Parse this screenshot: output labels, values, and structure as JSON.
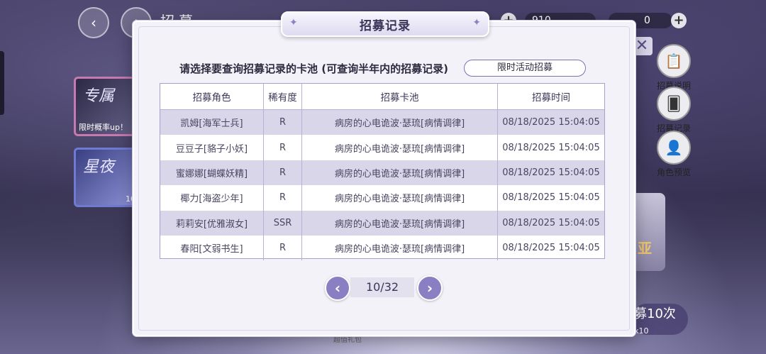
{
  "background": {
    "top_title": "招募",
    "currency_amount": "910",
    "currency_amount2": "0",
    "banners": [
      {
        "text": "专属",
        "tag": "限时概率up！"
      },
      {
        "text": "星夜",
        "tag": "10"
      }
    ],
    "side_menu": [
      {
        "label": "招募说明"
      },
      {
        "label": "招募记录"
      },
      {
        "label": "角色预览"
      }
    ],
    "recruit_button": "募10次",
    "recruit_count": "x10",
    "yellow_text": "亚",
    "bottom_tag": "超值礼包"
  },
  "modal": {
    "title": "招募记录",
    "prompt": "请选择要查询招募记录的卡池 (可查询半年内的招募记录)",
    "pool_button": "限时活动招募",
    "columns": [
      "招募角色",
      "稀有度",
      "招募卡池",
      "招募时间"
    ],
    "rows": [
      [
        "凯姆[海军士兵]",
        "R",
        "病房的心电诡波·瑟琉[病情调律]",
        "08/18/2025 15:04:05"
      ],
      [
        "豆豆子[貉子小妖]",
        "R",
        "病房的心电诡波·瑟琉[病情调律]",
        "08/18/2025 15:04:05"
      ],
      [
        "蜜娜娜[蝴蝶妖精]",
        "R",
        "病房的心电诡波·瑟琉[病情调律]",
        "08/18/2025 15:04:05"
      ],
      [
        "椰力[海盗少年]",
        "R",
        "病房的心电诡波·瑟琉[病情调律]",
        "08/18/2025 15:04:05"
      ],
      [
        "莉莉安[优雅淑女]",
        "SSR",
        "病房的心电诡波·瑟琉[病情调律]",
        "08/18/2025 15:04:05"
      ],
      [
        "春阳[文弱书生]",
        "R",
        "病房的心电诡波·瑟琉[病情调律]",
        "08/18/2025 15:04:05"
      ]
    ],
    "pagination": {
      "current": "10/32"
    }
  },
  "colors": {
    "accent": "#8b7fc4",
    "row_shade": "#d9d6ea",
    "border": "#a99fcf"
  }
}
